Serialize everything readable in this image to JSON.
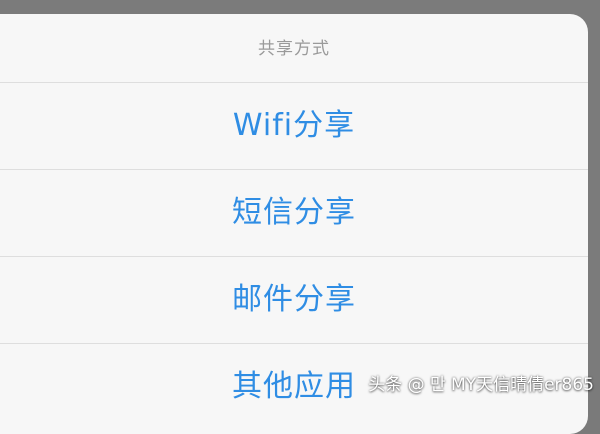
{
  "share_sheet": {
    "title": "共享方式",
    "options": [
      {
        "label": "Wifi分享"
      },
      {
        "label": "短信分享"
      },
      {
        "label": "邮件分享"
      },
      {
        "label": "其他应用"
      }
    ]
  },
  "watermark": {
    "text": "头条 @ 만 MY天信晴倩er865"
  },
  "colors": {
    "backdrop": "#7b7b7b",
    "sheet_background": "#f7f7f7",
    "option_text": "#2f8de4",
    "title_text": "#9a9a9a",
    "divider": "#dedede"
  }
}
